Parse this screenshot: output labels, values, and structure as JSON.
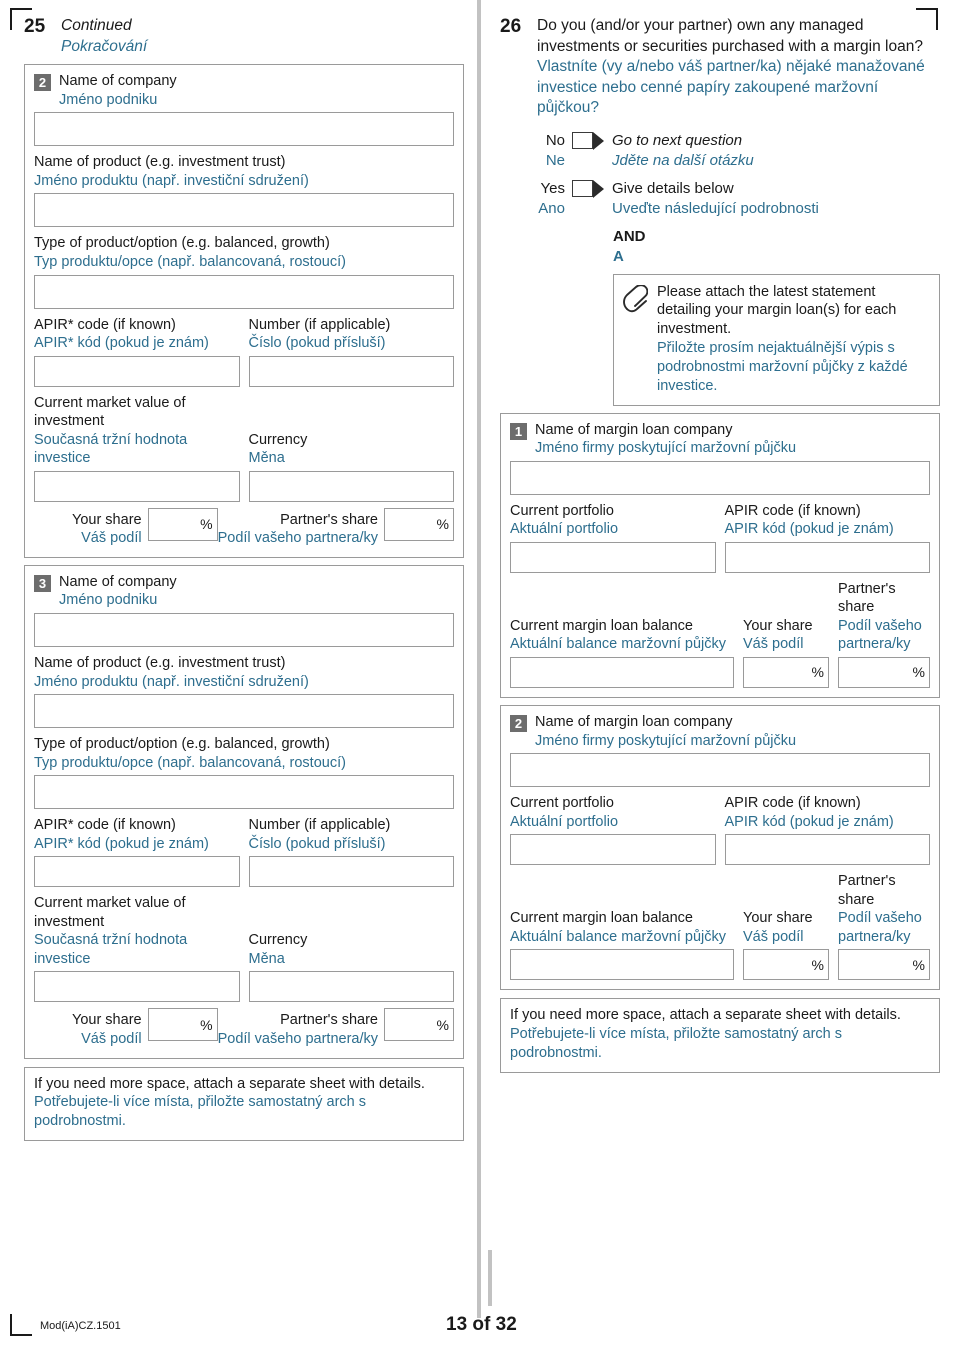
{
  "footer": {
    "form_code": "Mod(iA)CZ.1501",
    "page": "13 of 32"
  },
  "left": {
    "question_number": "25",
    "title_en": "Continued",
    "title_cz": "Pokračování",
    "labels": {
      "name_of_company_en": "Name of company",
      "name_of_company_cz": "Jméno podniku",
      "name_of_product_en": "Name of product (e.g. investment trust)",
      "name_of_product_cz": "Jméno produktu (např. investiční sdružení)",
      "type_of_product_en": "Type of product/option (e.g. balanced, growth)",
      "type_of_product_cz": "Typ produktu/opce (např. balancovaná, rostoucí)",
      "apir_en": "APIR* code (if known)",
      "apir_cz": "APIR* kód (pokud je znám)",
      "number_en": "Number (if applicable)",
      "number_cz": "Číslo (pokud přísluší)",
      "market_value_en": "Current market value of investment",
      "market_value_cz": "Současná tržní hodnota investice",
      "currency_en": "Currency",
      "currency_cz": "Měna",
      "your_share_en": "Your share",
      "your_share_cz": "Váš podíl",
      "partner_share_en": "Partner's share",
      "partner_share_cz": "Podíl vašeho partnera/ky",
      "percent": "%"
    },
    "blocks": [
      {
        "number": "2"
      },
      {
        "number": "3"
      }
    ],
    "note_en": "If you need more space, attach a separate sheet with details.",
    "note_cz": "Potřebujete-li více místa, přiložte samostatný arch s podrobnostmi."
  },
  "right": {
    "question_number": "26",
    "question_en": "Do you (and/or your partner) own any managed investments or securities purchased with a margin loan?",
    "question_cz": "Vlastníte (vy a/nebo váš partner/ka) nějaké manažované investice nebo cenné papíry zakoupené maržovní půjčkou?",
    "options": [
      {
        "label_en": "No",
        "label_cz": "Ne",
        "text_en": "Go to next question",
        "text_cz": "Jděte na další otázku",
        "italic": true
      },
      {
        "label_en": "Yes",
        "label_cz": "Ano",
        "text_en": "Give details below",
        "text_cz": "Uveďte následující podrobnosti",
        "italic": false
      }
    ],
    "and_en": "AND",
    "and_cz": "A",
    "attach_en": "Please attach the latest statement detailing your margin loan(s) for each investment.",
    "attach_cz": "Přiložte prosím nejaktuálnější výpis s podrobnostmi maržovní půjčky z každé investice.",
    "labels": {
      "margin_company_en": "Name of margin loan company",
      "margin_company_cz": "Jméno firmy poskytující maržovní půjčku",
      "portfolio_en": "Current portfolio",
      "portfolio_cz": "Aktuální portfolio",
      "apir_en": "APIR code (if known)",
      "apir_cz": "APIR kód (pokud je znám)",
      "balance_en": "Current margin loan balance",
      "balance_cz": "Aktuální balance maržovní půjčky",
      "your_share_en": "Your share",
      "your_share_cz": "Váš podíl",
      "partner_share_en": "Partner's share",
      "partner_share_cz": "Podíl vašeho partnera/ky",
      "percent": "%"
    },
    "blocks": [
      {
        "number": "1"
      },
      {
        "number": "2"
      }
    ],
    "note_en": "If you need more space, attach a separate sheet with details.",
    "note_cz": "Potřebujete-li více místa, přiložte samostatný arch s podrobnostmi."
  },
  "icons": {
    "paperclip": "paperclip-icon"
  }
}
